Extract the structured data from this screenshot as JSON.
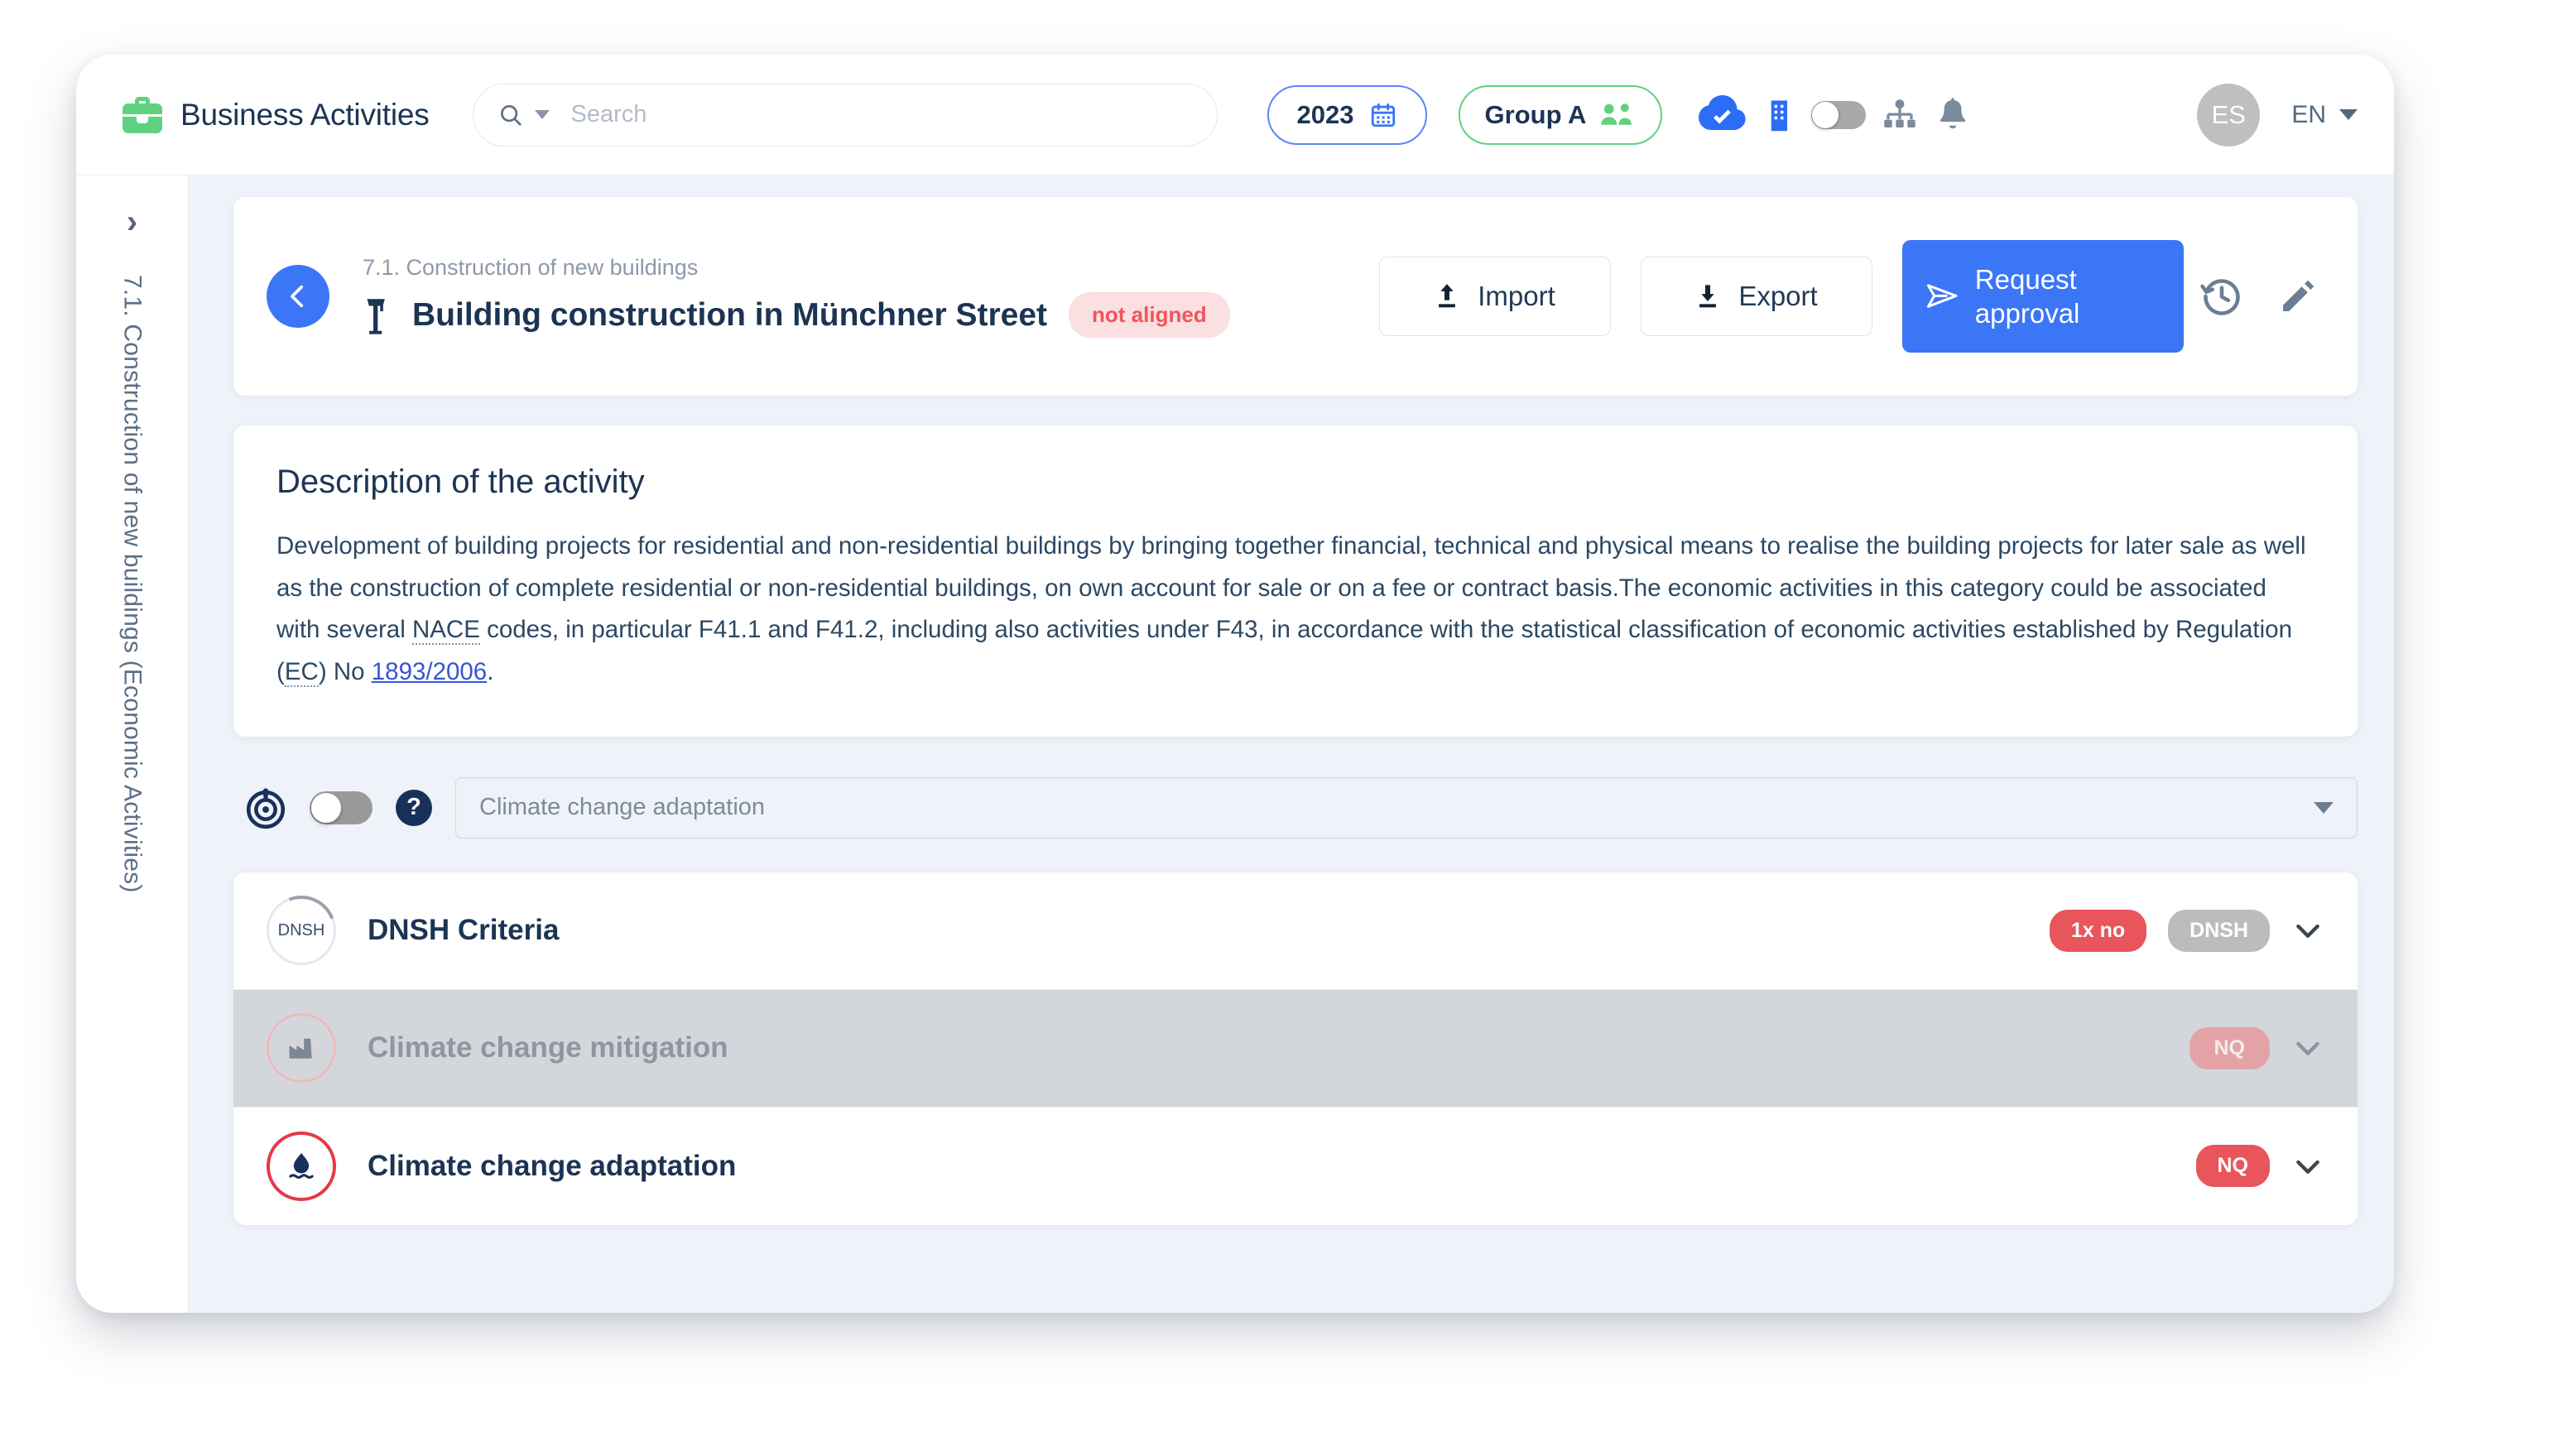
{
  "app": {
    "brand_title": "Business Activities",
    "logo_icon": "briefcase-icon",
    "brand_color": "#5ed27f"
  },
  "topbar": {
    "search": {
      "placeholder": "Search",
      "value": "",
      "icon": "search-icon"
    },
    "year_selector": {
      "label": "2023",
      "icon": "calendar-icon",
      "border_color": "#5b86f7"
    },
    "group_selector": {
      "label": "Group A",
      "icon": "people-icon",
      "border_color": "#5ed27f"
    },
    "cloud_status_icon": "cloud-check-icon",
    "building_icon": "building-icon",
    "header_toggle": {
      "state": "off"
    },
    "hierarchy_icon": "org-chart-icon",
    "notifications_icon": "bell-icon",
    "avatar_initials": "ES",
    "language": {
      "label": "EN",
      "icon": "chevron-down-icon"
    }
  },
  "sidebar": {
    "expand_icon": "chevron-right-icon",
    "vertical_label": "7.1. Construction of new buildings (Economic Activities)"
  },
  "activity_header": {
    "back_icon": "chevron-left-icon",
    "breadcrumb": "7.1. Construction of new buildings",
    "title_icon": "construction-crane-icon",
    "title": "Building construction in Münchner Street",
    "status_badge": "not aligned",
    "status_badge_color": "#f1555a",
    "import_label": "Import",
    "import_icon": "upload-icon",
    "export_label": "Export",
    "export_icon": "download-icon",
    "request_approval_label": "Request approval",
    "request_approval_icon": "send-icon",
    "request_approval_color": "#3b76f6",
    "history_icon": "history-clock-icon",
    "edit_icon": "pencil-icon"
  },
  "description": {
    "heading": "Description of the activity",
    "part1": "Development of building projects for residential and non-residential buildings by bringing together financial, technical and physical means to realise the building projects for later sale as well as the construction of complete residential or non-residential buildings, on own account for sale or on a fee or contract basis.The economic activities in this category could be associated with several ",
    "abbr1": "NACE",
    "part2": " codes, in particular F41.1 and F41.2, including also activities under F43, in accordance with the statistical classification of economic activities established by Regulation (",
    "abbr2": "EC",
    "part3": ") No ",
    "link": "1893/2006",
    "part4": "."
  },
  "objective_control": {
    "power_icon": "power-target-icon",
    "toggle_state": "off",
    "help_icon": "help-circle-icon",
    "selected_objective": "Climate change adaptation",
    "dropdown_icon": "chevron-down-icon"
  },
  "criteria_rows": [
    {
      "id": "dnsh",
      "icon_label": "DNSH",
      "icon_name": "dnsh-progress-ring",
      "label": "DNSH Criteria",
      "badges": [
        "1x no",
        "DNSH"
      ],
      "state": "active",
      "expand_icon": "chevron-down-icon"
    },
    {
      "id": "mitigation",
      "icon_name": "factory-icon",
      "label": "Climate change mitigation",
      "badges": [
        "NQ"
      ],
      "state": "disabled",
      "expand_icon": "chevron-down-icon"
    },
    {
      "id": "adaptation",
      "icon_name": "flood-water-icon",
      "label": "Climate change adaptation",
      "badges": [
        "NQ"
      ],
      "state": "active",
      "expand_icon": "chevron-down-icon"
    }
  ]
}
